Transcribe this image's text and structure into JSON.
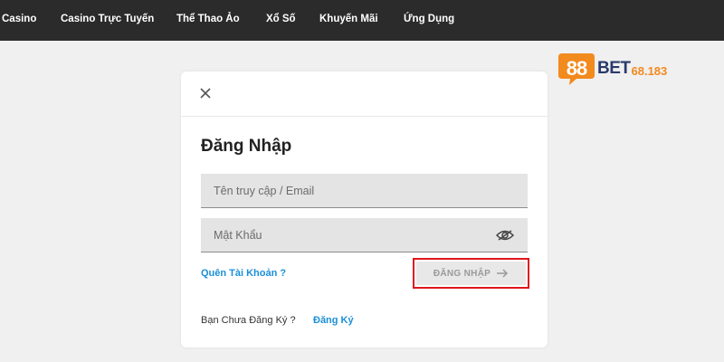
{
  "nav": {
    "items": [
      {
        "label": "Casino"
      },
      {
        "label": "Casino Trực Tuyến"
      },
      {
        "label": "Thể Thao Ảo"
      },
      {
        "label": "Xổ Số"
      },
      {
        "label": "Khuyến Mãi"
      },
      {
        "label": "Ứng Dụng"
      }
    ]
  },
  "logo": {
    "badge": "88",
    "brand": "BET",
    "domain": "68.183"
  },
  "login_modal": {
    "title": "Đăng Nhập",
    "username_placeholder": "Tên truy cập / Email",
    "password_placeholder": "Mật Khẩu",
    "forgot_link": "Quên Tài Khoản ?",
    "login_button": "ĐĂNG NHẬP",
    "register_prompt": "Bạn Chưa Đăng Ký ?",
    "register_link": "Đăng Ký"
  },
  "colors": {
    "nav_bg": "#2b2b2b",
    "link_blue": "#1b8fd8",
    "highlight_red": "#e0161e",
    "logo_orange": "#f28a1e"
  }
}
